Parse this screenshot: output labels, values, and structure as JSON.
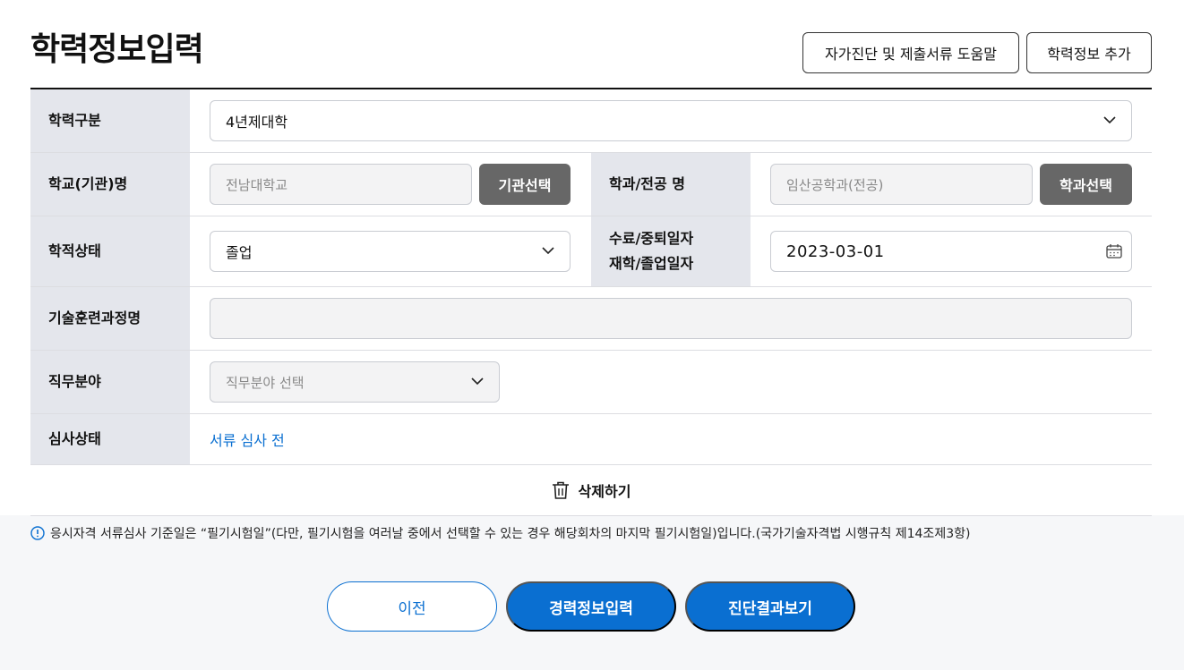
{
  "page": {
    "title": "학력정보입력",
    "help_button": "자가진단 및 제출서류 도움말",
    "add_button": "학력정보 추가"
  },
  "form": {
    "edu_type": {
      "label": "학력구분",
      "value": "4년제대학"
    },
    "school": {
      "label": "학교(기관)명",
      "value": "전남대학교",
      "button": "기관선택"
    },
    "major": {
      "label": "학과/전공 명",
      "value": "임산공학과(전공)",
      "button": "학과선택"
    },
    "status": {
      "label": "학적상태",
      "value": "졸업"
    },
    "date": {
      "label_line1": "수료/중퇴일자",
      "label_line2": "재학/졸업일자",
      "value": "2023-03-01"
    },
    "training": {
      "label": "기술훈련과정명",
      "value": ""
    },
    "job_field": {
      "label": "직무분야",
      "placeholder": "직무분야 선택"
    },
    "review": {
      "label": "심사상태",
      "value": "서류 심사 전"
    },
    "delete_button": "삭제하기"
  },
  "notice": "응시자격 서류심사 기준일은 “필기시험일”(다만, 필기시험을 여러날 중에서 선택할 수 있는 경우 해당회차의 마지막 필기시험일)입니다.(국가기술자격법 시행규칙 제14조제3항)",
  "buttons": {
    "prev": "이전",
    "career": "경력정보입력",
    "result": "진단결과보기"
  },
  "colors": {
    "accent": "#0a6fd1",
    "header_cell": "#e4e6ec",
    "dark_button": "#676767"
  }
}
